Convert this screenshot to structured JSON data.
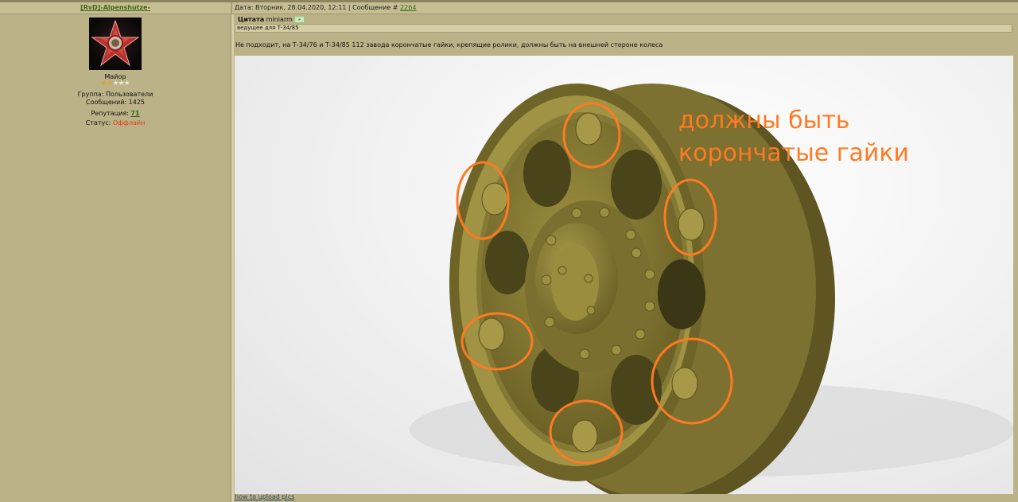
{
  "author": {
    "name": "[RvD]-Alpenshutze-",
    "rank": "Майор",
    "stars_filled": 2,
    "stars_total": 5,
    "group_label": "Группа:",
    "group_value": "Пользователи",
    "posts_label": "Сообщений:",
    "posts_value": "1425",
    "rep_label": "Репутация:",
    "rep_value": "71",
    "status_label": "Статус:",
    "status_value": "Оффлайн"
  },
  "post": {
    "date_label": "Дата: Вторник, 28.04.2020, 12:11 | Сообщение #",
    "number": "2264"
  },
  "quote": {
    "label": "Цитата",
    "author": "miniarm",
    "text": "ведущее для Т-34/85"
  },
  "body": {
    "text": "Не подходит, на Т-34/76 и Т-34/85 112 завода корончатые гайки, крепящие ролики, должны быть на внешней стороне колеса"
  },
  "image": {
    "annotation_line1": "должны быть",
    "annotation_line2": "корончатые гайки",
    "annotation_color": "#ff7a22",
    "wheel_color": "#8f8336"
  },
  "footer": {
    "link": "how to upload pics"
  }
}
